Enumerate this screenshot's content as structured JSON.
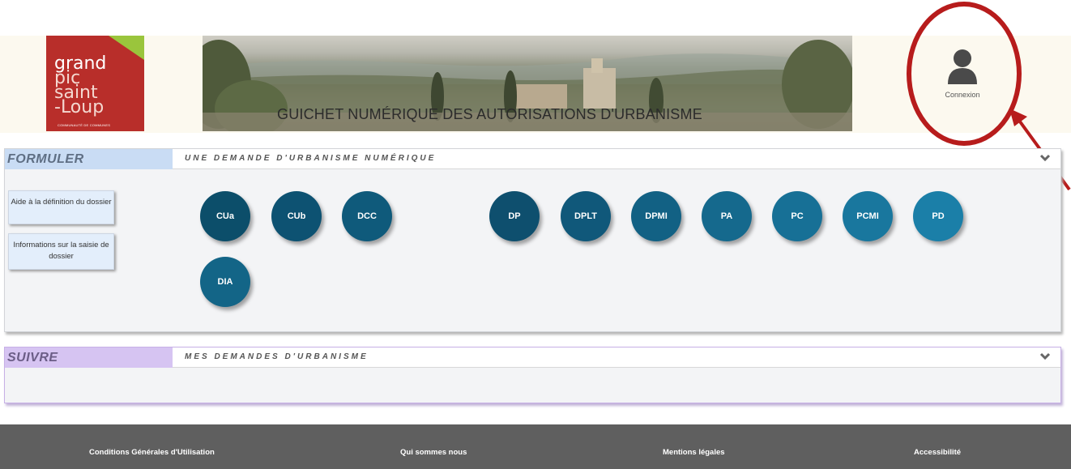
{
  "logo": {
    "lines": [
      "grand",
      "pic",
      "saint",
      "-Loup"
    ],
    "subtitle": "COMMUNAUTÉ DE COMMUNES"
  },
  "banner": {
    "title": "GUICHET NUMÉRIQUE DES AUTORISATIONS D'URBANISME"
  },
  "account": {
    "label": "Connexion",
    "icon": "user-icon"
  },
  "formuler": {
    "tab": "FORMULER",
    "subtitle": "UNE DEMANDE D'URBANISME NUMÉRIQUE",
    "help_buttons": [
      "Aide à la définition du dossier",
      "Informations sur la saisie de dossier"
    ],
    "bubbles": [
      "CUa",
      "CUb",
      "DCC",
      "DP",
      "DPLT",
      "DPMI",
      "PA",
      "PC",
      "PCMI",
      "PD",
      "DIA"
    ]
  },
  "suivre": {
    "tab": "SUIVRE",
    "subtitle": "MES DEMANDES D'URBANISME"
  },
  "footer": {
    "links": [
      "Conditions Générales d'Utilisation",
      "Qui sommes nous",
      "Mentions légales",
      "Accessibilité"
    ]
  },
  "colors": {
    "logo_red": "#b82e2a",
    "logo_green": "#9ac53c",
    "bubble_dark": "#0e4f6e",
    "bubble_light": "#1b7fa8",
    "annotation_red": "#b71c1c",
    "footer_bg": "#5f5f5f"
  }
}
